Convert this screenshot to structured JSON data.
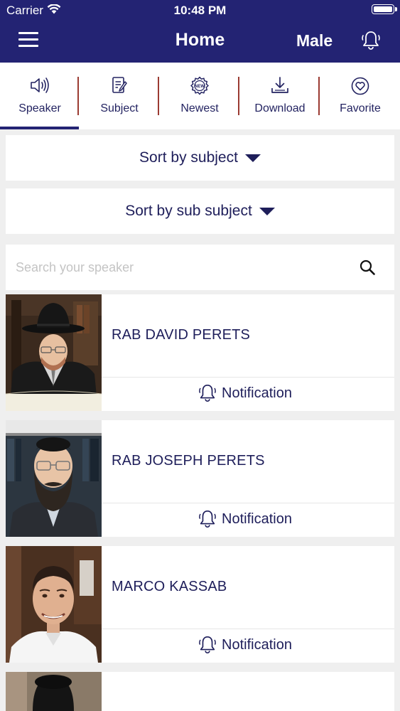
{
  "status": {
    "carrier": "Carrier",
    "time": "10:48 PM"
  },
  "nav": {
    "title": "Home",
    "gender": "Male"
  },
  "tabs": [
    {
      "label": "Speaker",
      "icon": "speaker-icon"
    },
    {
      "label": "Subject",
      "icon": "subject-icon"
    },
    {
      "label": "Newest",
      "icon": "new-badge-icon"
    },
    {
      "label": "Download",
      "icon": "download-icon"
    },
    {
      "label": "Favorite",
      "icon": "heart-icon"
    }
  ],
  "active_tab": "Speaker",
  "sort": {
    "subject_label": "Sort by subject",
    "sub_subject_label": "Sort by sub subject"
  },
  "search": {
    "placeholder": "Search your speaker",
    "value": ""
  },
  "speakers": [
    {
      "name": "RAB DAVID PERETS",
      "notification_label": "Notification"
    },
    {
      "name": "RAB JOSEPH PERETS",
      "notification_label": "Notification"
    },
    {
      "name": "MARCO KASSAB",
      "notification_label": "Notification"
    },
    {
      "name": "",
      "notification_label": ""
    }
  ],
  "colors": {
    "nav_bg": "#232373",
    "text_primary": "#1e1e5a",
    "tab_separator": "#9b3b32",
    "page_bg": "#efefef"
  }
}
